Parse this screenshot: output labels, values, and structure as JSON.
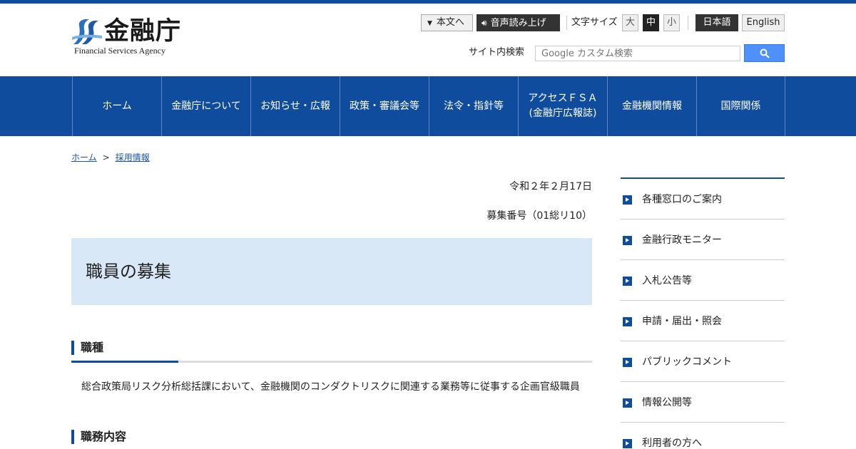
{
  "header": {
    "logo_name": "金融庁",
    "logo_en": "Financial Services Agency",
    "skip_label": "本文へ",
    "voice_label": "音声読み上げ",
    "font_size_label": "文字サイズ",
    "font_sizes": [
      "大",
      "中",
      "小"
    ],
    "lang_jp": "日本語",
    "lang_en": "English",
    "search_label": "サイト内検索",
    "search_placeholder": "Google カスタム検索"
  },
  "nav": {
    "items": [
      {
        "label": "ホーム"
      },
      {
        "label": "金融庁について"
      },
      {
        "label": "お知らせ・広報"
      },
      {
        "label": "政策・審議会等"
      },
      {
        "label": "法令・指針等"
      },
      {
        "label": "アクセスＦＳＡ",
        "label2": "(金融庁広報誌)"
      },
      {
        "label": "金融機関情報"
      },
      {
        "label": "国際関係"
      }
    ]
  },
  "breadcrumb": {
    "home": "ホーム",
    "separator": ">",
    "current": "採用情報"
  },
  "main": {
    "date": "令和２年２月17日",
    "recruit_no": "募集番号（01総リ10）",
    "title": "職員の募集",
    "section1_title": "職種",
    "section1_body": "総合政策局リスク分析総括課において、金融機関のコンダクトリスクに関連する業務等に従事する企画官級職員",
    "section2_title": "職務内容"
  },
  "sidebar": {
    "items": [
      {
        "label": "各種窓口のご案内"
      },
      {
        "label": "金融行政モニター"
      },
      {
        "label": "入札公告等"
      },
      {
        "label": "申請・届出・照会"
      },
      {
        "label": "パブリックコメント"
      },
      {
        "label": "情報公開等"
      },
      {
        "label": "利用者の方へ"
      }
    ]
  },
  "colors": {
    "brand": "#0f4c9e",
    "title_bg": "#d9e8f7",
    "search_button": "#4d90fe"
  },
  "icons": {
    "skip": "triangle-down-icon",
    "voice": "speaker-icon",
    "search": "magnifier-icon",
    "side": "arrow-right-square-icon"
  }
}
